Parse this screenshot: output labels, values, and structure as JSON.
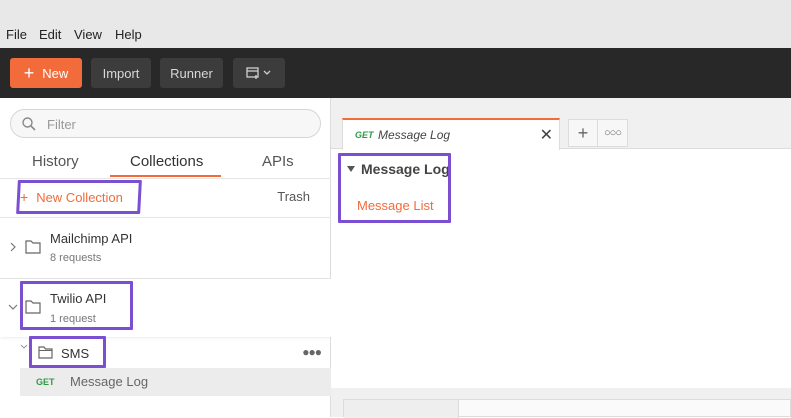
{
  "menubar": {
    "items": [
      "File",
      "Edit",
      "View",
      "Help"
    ]
  },
  "toolbar": {
    "new_label": "New",
    "import_label": "Import",
    "runner_label": "Runner"
  },
  "sidebar": {
    "filter_placeholder": "Filter",
    "tabs": [
      "History",
      "Collections",
      "APIs"
    ],
    "active_tab": "Collections",
    "new_collection_label": "New Collection",
    "trash_label": "Trash",
    "collections": [
      {
        "name": "Mailchimp API",
        "count": "8 requests",
        "expanded": false
      },
      {
        "name": "Twilio API",
        "count": "1 request",
        "expanded": true
      }
    ],
    "folder": {
      "name": "SMS"
    },
    "request": {
      "method": "GET",
      "name": "Message Log"
    }
  },
  "main": {
    "tab": {
      "method": "GET",
      "title": "Message Log"
    },
    "folder_title": "Message Log",
    "link": "Message List"
  },
  "colors": {
    "accent": "#f26b3a",
    "get_method": "#2f9b45",
    "highlight": "#7b4fd1",
    "toolbar_bg": "#282828"
  },
  "icons": [
    "search-icon",
    "plus-icon",
    "chevron-right-icon",
    "chevron-down-icon",
    "collection-icon",
    "folder-icon",
    "close-icon",
    "more-icon",
    "new-window-icon"
  ]
}
